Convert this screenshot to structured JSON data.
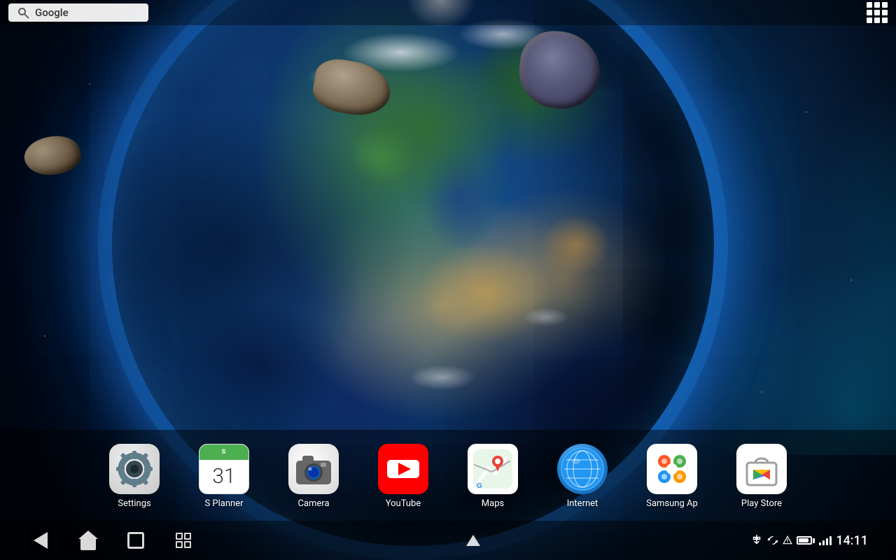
{
  "wallpaper": {
    "description": "Earth from space with asteroids - live wallpaper"
  },
  "status_bar": {
    "search_label": "Google",
    "search_placeholder": "Google"
  },
  "dock": {
    "apps": [
      {
        "id": "settings",
        "label": "Settings",
        "type": "settings"
      },
      {
        "id": "splanner",
        "label": "S Planner",
        "type": "splanner",
        "date": "31"
      },
      {
        "id": "camera",
        "label": "Camera",
        "type": "camera"
      },
      {
        "id": "youtube",
        "label": "YouTube",
        "type": "youtube"
      },
      {
        "id": "maps",
        "label": "Maps",
        "type": "maps"
      },
      {
        "id": "internet",
        "label": "Internet",
        "type": "internet"
      },
      {
        "id": "samsung",
        "label": "Samsung Ap",
        "type": "samsung"
      },
      {
        "id": "playstore",
        "label": "Play Store",
        "type": "playstore"
      }
    ]
  },
  "nav_bar": {
    "back_label": "Back",
    "home_label": "Home",
    "recents_label": "Recent Apps",
    "screenshot_label": "Screenshot",
    "up_label": "Up"
  },
  "status_right": {
    "time": "14:11",
    "signal": "signal",
    "battery": "battery"
  },
  "colors": {
    "accent_blue": "#1a88d0",
    "dock_bg": "rgba(0,0,0,0.45)",
    "nav_bg": "rgba(0,0,0,0.7)"
  }
}
